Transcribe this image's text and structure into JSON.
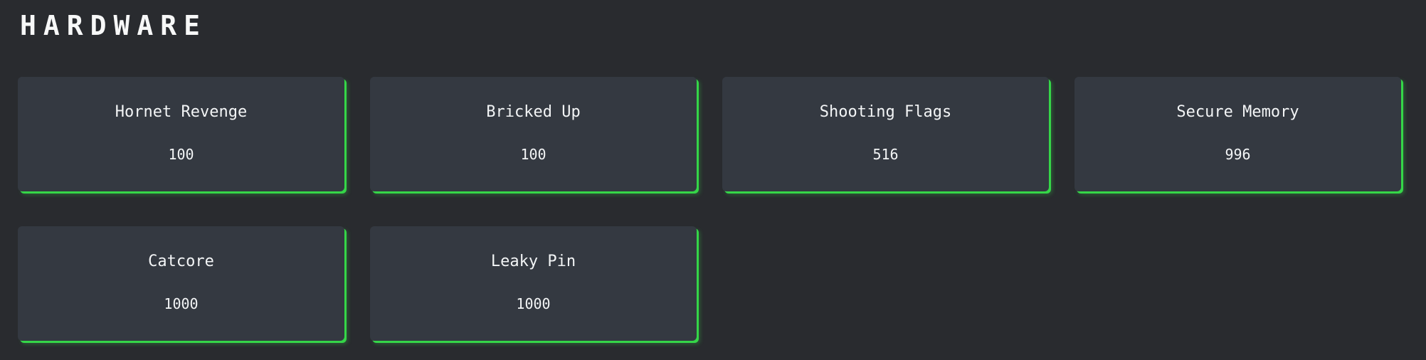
{
  "category": {
    "title": "HARDWARE"
  },
  "colors": {
    "background": "#292b2f",
    "card_background": "#343941",
    "card_accent": "#35d648",
    "text": "#f3f5f6"
  },
  "challenges": [
    {
      "name": "Hornet Revenge",
      "points": "100"
    },
    {
      "name": "Bricked Up",
      "points": "100"
    },
    {
      "name": "Shooting Flags",
      "points": "516"
    },
    {
      "name": "Secure Memory",
      "points": "996"
    },
    {
      "name": "Catcore",
      "points": "1000"
    },
    {
      "name": "Leaky Pin",
      "points": "1000"
    }
  ]
}
